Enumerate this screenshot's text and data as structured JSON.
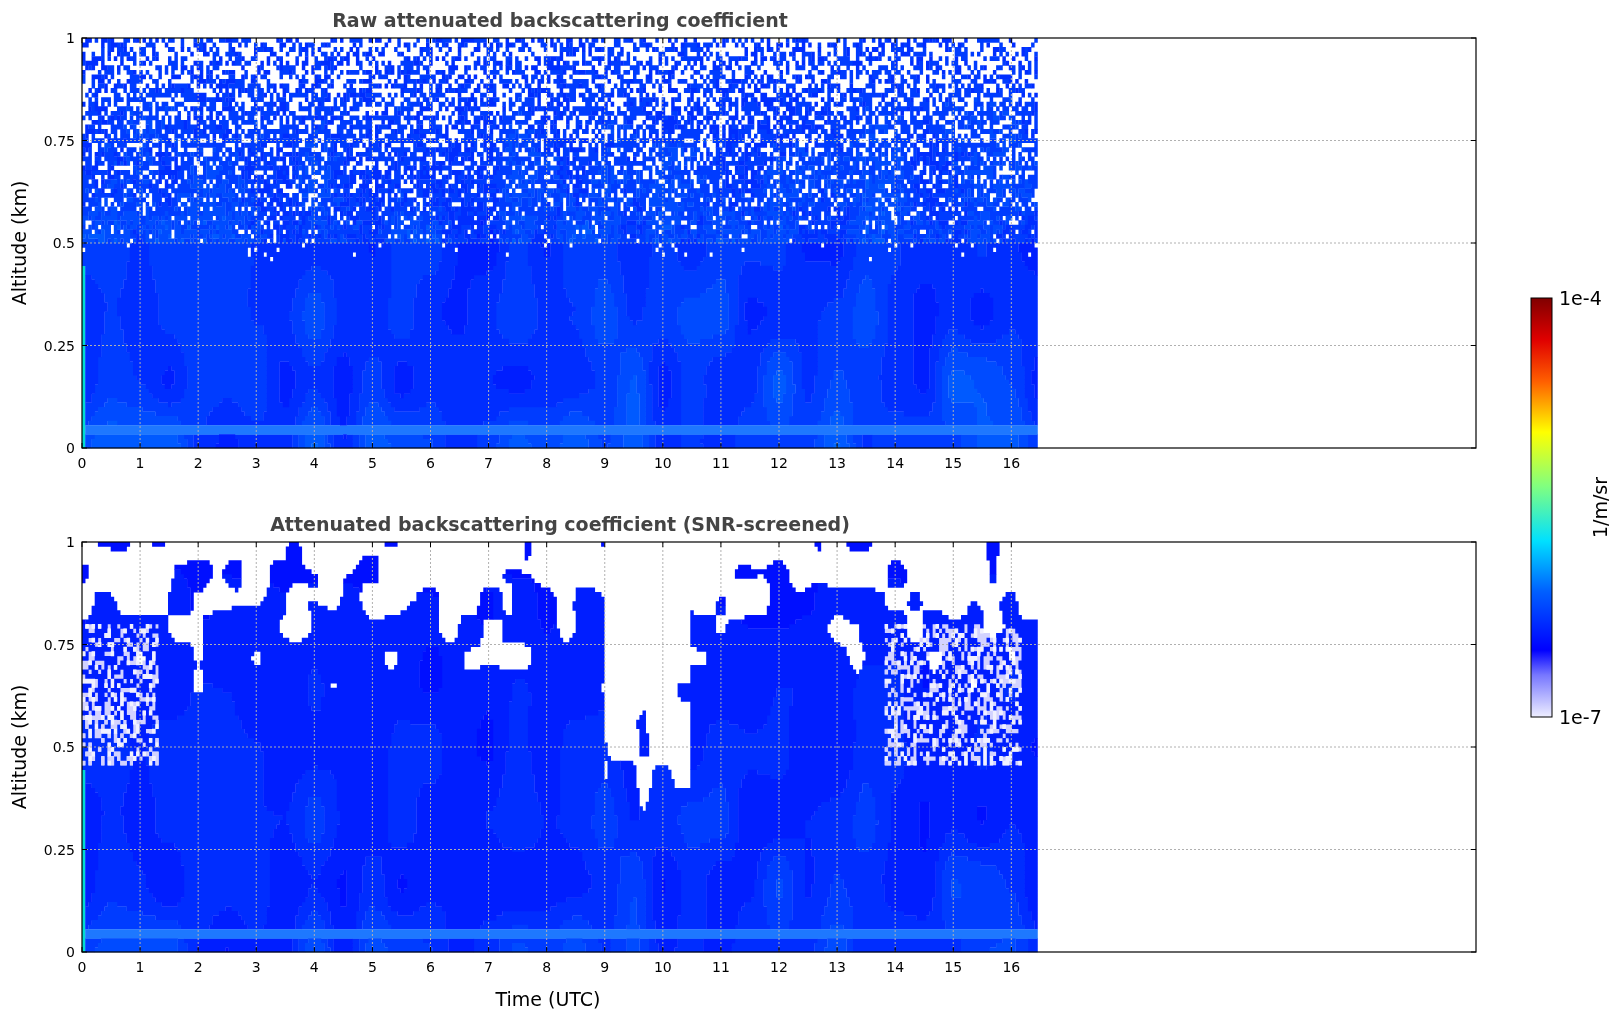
{
  "panels": [
    {
      "title": "Raw attenuated backscattering coefficient",
      "kind": "raw",
      "ylabel": "Altitude (km)",
      "yticks": [
        "1",
        "0.75",
        "0.5",
        "0.25",
        "0"
      ],
      "xticks": [
        "0",
        "1",
        "2",
        "3",
        "4",
        "5",
        "6",
        "7",
        "8",
        "9",
        "10",
        "11",
        "12",
        "13",
        "14",
        "15",
        "16"
      ]
    },
    {
      "title": "Attenuated backscattering coefficient (SNR-screened)",
      "kind": "snr",
      "ylabel": "Altitude (km)",
      "yticks": [
        "1",
        "0.75",
        "0.5",
        "0.25",
        "0"
      ],
      "xticks": [
        "0",
        "1",
        "2",
        "3",
        "4",
        "5",
        "6",
        "7",
        "8",
        "9",
        "10",
        "11",
        "12",
        "13",
        "14",
        "15",
        "16"
      ]
    }
  ],
  "xlabel": "Time (UTC)",
  "colorbar": {
    "max": "1e-4",
    "min": "1e-7",
    "label": "1/m/sr"
  }
}
